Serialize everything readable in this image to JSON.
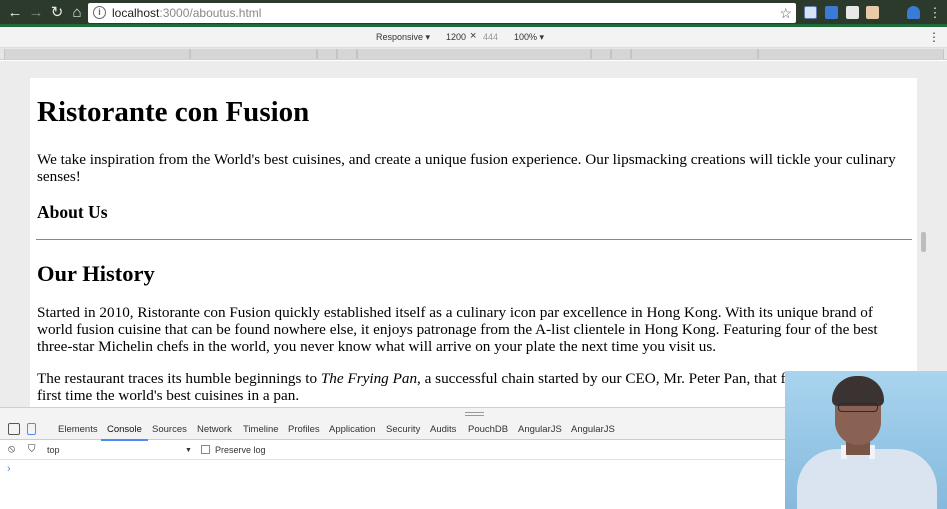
{
  "browser": {
    "url_host": "localhost",
    "url_path": ":3000/aboutus.html",
    "accent": "#1f6a3a"
  },
  "device_toolbar": {
    "mode": "Responsive ▾",
    "width": "1200",
    "times": "×",
    "height": "444",
    "zoom": "100% ▾"
  },
  "page": {
    "title": "Ristorante con Fusion",
    "lead": "We take inspiration from the World's best cuisines, and create a unique fusion experience. Our lipsmacking creations will tickle your culinary senses!",
    "about_heading": "About Us",
    "history_heading": "Our History",
    "history_p1": "Started in 2010, Ristorante con Fusion quickly established itself as a culinary icon par excellence in Hong Kong. With its unique brand of world fusion cuisine that can be found nowhere else, it enjoys patronage from the A-list clientele in Hong Kong. Featuring four of the best three-star Michelin chefs in the world, you never know what will arrive on your plate the next time you visit us.",
    "history_p2_before": "The restaurant traces its humble beginnings to ",
    "history_p2_em": "The Frying Pan",
    "history_p2_after": ", a successful chain started by our CEO, Mr. Peter Pan, that featured for the first time the world's best cuisines in a pan."
  },
  "devtools": {
    "tabs": [
      "Elements",
      "Console",
      "Sources",
      "Network",
      "Timeline",
      "Profiles",
      "Application",
      "Security",
      "Audits",
      "PouchDB",
      "AngularJS",
      "AngularJS"
    ],
    "active_tab": "Console",
    "context": "top",
    "context_arrow": "▼",
    "preserve_log": "Preserve log",
    "prompt": "›"
  }
}
